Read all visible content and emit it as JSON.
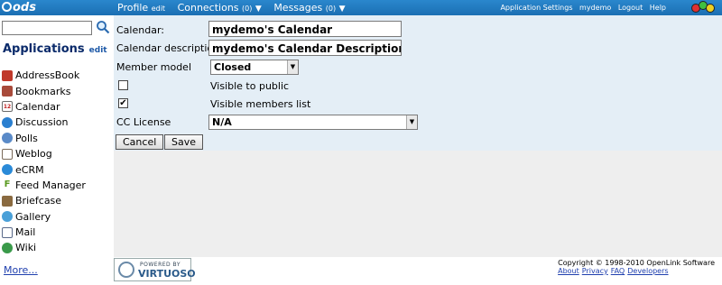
{
  "topbar": {
    "logo": "ods",
    "profile": "Profile",
    "profile_edit": "edit",
    "connections": "Connections",
    "connections_count": "(0)",
    "messages": "Messages",
    "messages_count": "(0)",
    "links": [
      "Application Settings",
      "mydemo",
      "Logout",
      "Help"
    ]
  },
  "sidebar": {
    "search_value": "",
    "apps_title": "Applications",
    "apps_edit": "edit",
    "apps": [
      {
        "label": "AddressBook",
        "icon": "addressbook-icon",
        "color": "#c0392b"
      },
      {
        "label": "Bookmarks",
        "icon": "bookmarks-icon",
        "color": "#a84a3a"
      },
      {
        "label": "Calendar",
        "icon": "calendar-icon",
        "color": "#6a6a6a"
      },
      {
        "label": "Discussion",
        "icon": "discussion-icon",
        "color": "#2a7fd0"
      },
      {
        "label": "Polls",
        "icon": "polls-icon",
        "color": "#5a8ac8"
      },
      {
        "label": "Weblog",
        "icon": "weblog-icon",
        "color": "#7a6a5a"
      },
      {
        "label": "eCRM",
        "icon": "ecrm-icon",
        "color": "#2a8ad8"
      },
      {
        "label": "Feed Manager",
        "icon": "feed-manager-icon",
        "color": "#e8a020"
      },
      {
        "label": "Briefcase",
        "icon": "briefcase-icon",
        "color": "#8a6a40"
      },
      {
        "label": "Gallery",
        "icon": "gallery-icon",
        "color": "#4aa0d8"
      },
      {
        "label": "Mail",
        "icon": "mail-icon",
        "color": "#5a6a8a"
      },
      {
        "label": "Wiki",
        "icon": "wiki-icon",
        "color": "#3a9a4a"
      }
    ],
    "more": "More..."
  },
  "form": {
    "calendar_label": "Calendar:",
    "calendar_value": "mydemo's Calendar",
    "description_label": "Calendar description",
    "description_value": "mydemo's Calendar Description",
    "member_model_label": "Member model",
    "member_model_value": "Closed",
    "visible_public_label": "Visible to public",
    "visible_public_checked": false,
    "visible_members_label": "Visible members list",
    "visible_members_checked": true,
    "cc_license_label": "CC License",
    "cc_license_value": "N/A",
    "cancel_label": "Cancel",
    "save_label": "Save"
  },
  "footer": {
    "badge_top": "POWERED BY",
    "badge_name": "VIRTUOSO",
    "copyright": "Copyright © 1998-2010 OpenLink Software",
    "links": [
      "About",
      "Privacy",
      "FAQ",
      "Developers"
    ]
  },
  "colors": {
    "topbar": "#1b6fb3",
    "form_bg": "#e4eef6",
    "lower_bg": "#eeeeee",
    "link": "#1f3fae"
  }
}
